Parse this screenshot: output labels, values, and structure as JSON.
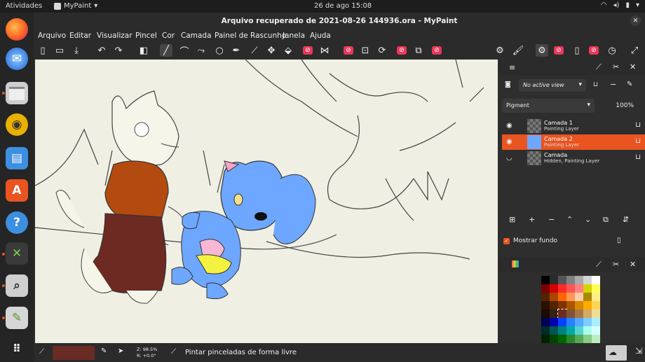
{
  "topbar": {
    "activities": "Atividades",
    "app_name": "MyPaint",
    "clock": "26 de ago  15:08"
  },
  "window": {
    "title": "Arquivo recuperado de 2021-08-26 144936.ora - MyPaint"
  },
  "menu": [
    "Arquivo",
    "Editar",
    "Visualizar",
    "Pincel",
    "Cor",
    "Camada",
    "Painel de Rascunho",
    "Janela",
    "Ajuda"
  ],
  "layers_panel": {
    "view_select": "No active view",
    "blend_mode": "Pigment",
    "opacity": "100%",
    "layers": [
      {
        "name": "Camada 1",
        "subtitle": "Painting Layer",
        "active": false,
        "visible": true
      },
      {
        "name": "Camada 2",
        "subtitle": "Painting Layer",
        "active": true,
        "visible": true
      },
      {
        "name": "Camada",
        "subtitle": "Hidden, Painting Layer",
        "active": false,
        "visible": false
      }
    ],
    "show_background": "Mostrar fundo"
  },
  "statusbar": {
    "zoom": "Z: 98.5%",
    "rotation": "R: +0.0°",
    "mode_text": "Pintar pinceladas de forma livre"
  },
  "colors": {
    "accent": "#e95420",
    "current_color": "#6a2b25",
    "canvas_bg": "#efefe3"
  },
  "palette": [
    [
      "#000000",
      "#2a2a2a",
      "#555555",
      "#808080",
      "#aaaaaa",
      "#d4d4d4",
      "#ffffff"
    ],
    [
      "#7a0000",
      "#d40000",
      "#ff2a2a",
      "#ff5555",
      "#ff8080",
      "#d4d400",
      "#ffff55"
    ],
    [
      "#552200",
      "#aa4400",
      "#ff6600",
      "#ff9955",
      "#ffccaa",
      "#aa8800",
      "#ffee88"
    ],
    [
      "#2b1100",
      "#552200",
      "#803300",
      "#aa5500",
      "#d48800",
      "#ffaa00",
      "#ffd455"
    ],
    [
      "#1a0a00",
      "#332211",
      "#6a2b25",
      "#805533",
      "#aa7744",
      "#d4aa66",
      "#eedd99"
    ],
    [
      "#000055",
      "#0000aa",
      "#0044ff",
      "#2a7fff",
      "#55aaff",
      "#80ccff",
      "#aaeeff"
    ],
    [
      "#002b2b",
      "#005555",
      "#008080",
      "#00aaaa",
      "#55d4d4",
      "#aaffee",
      "#d4ffff"
    ],
    [
      "#002200",
      "#004400",
      "#006600",
      "#2a8a2a",
      "#55aa55",
      "#88cc88",
      "#bbeebb"
    ]
  ]
}
